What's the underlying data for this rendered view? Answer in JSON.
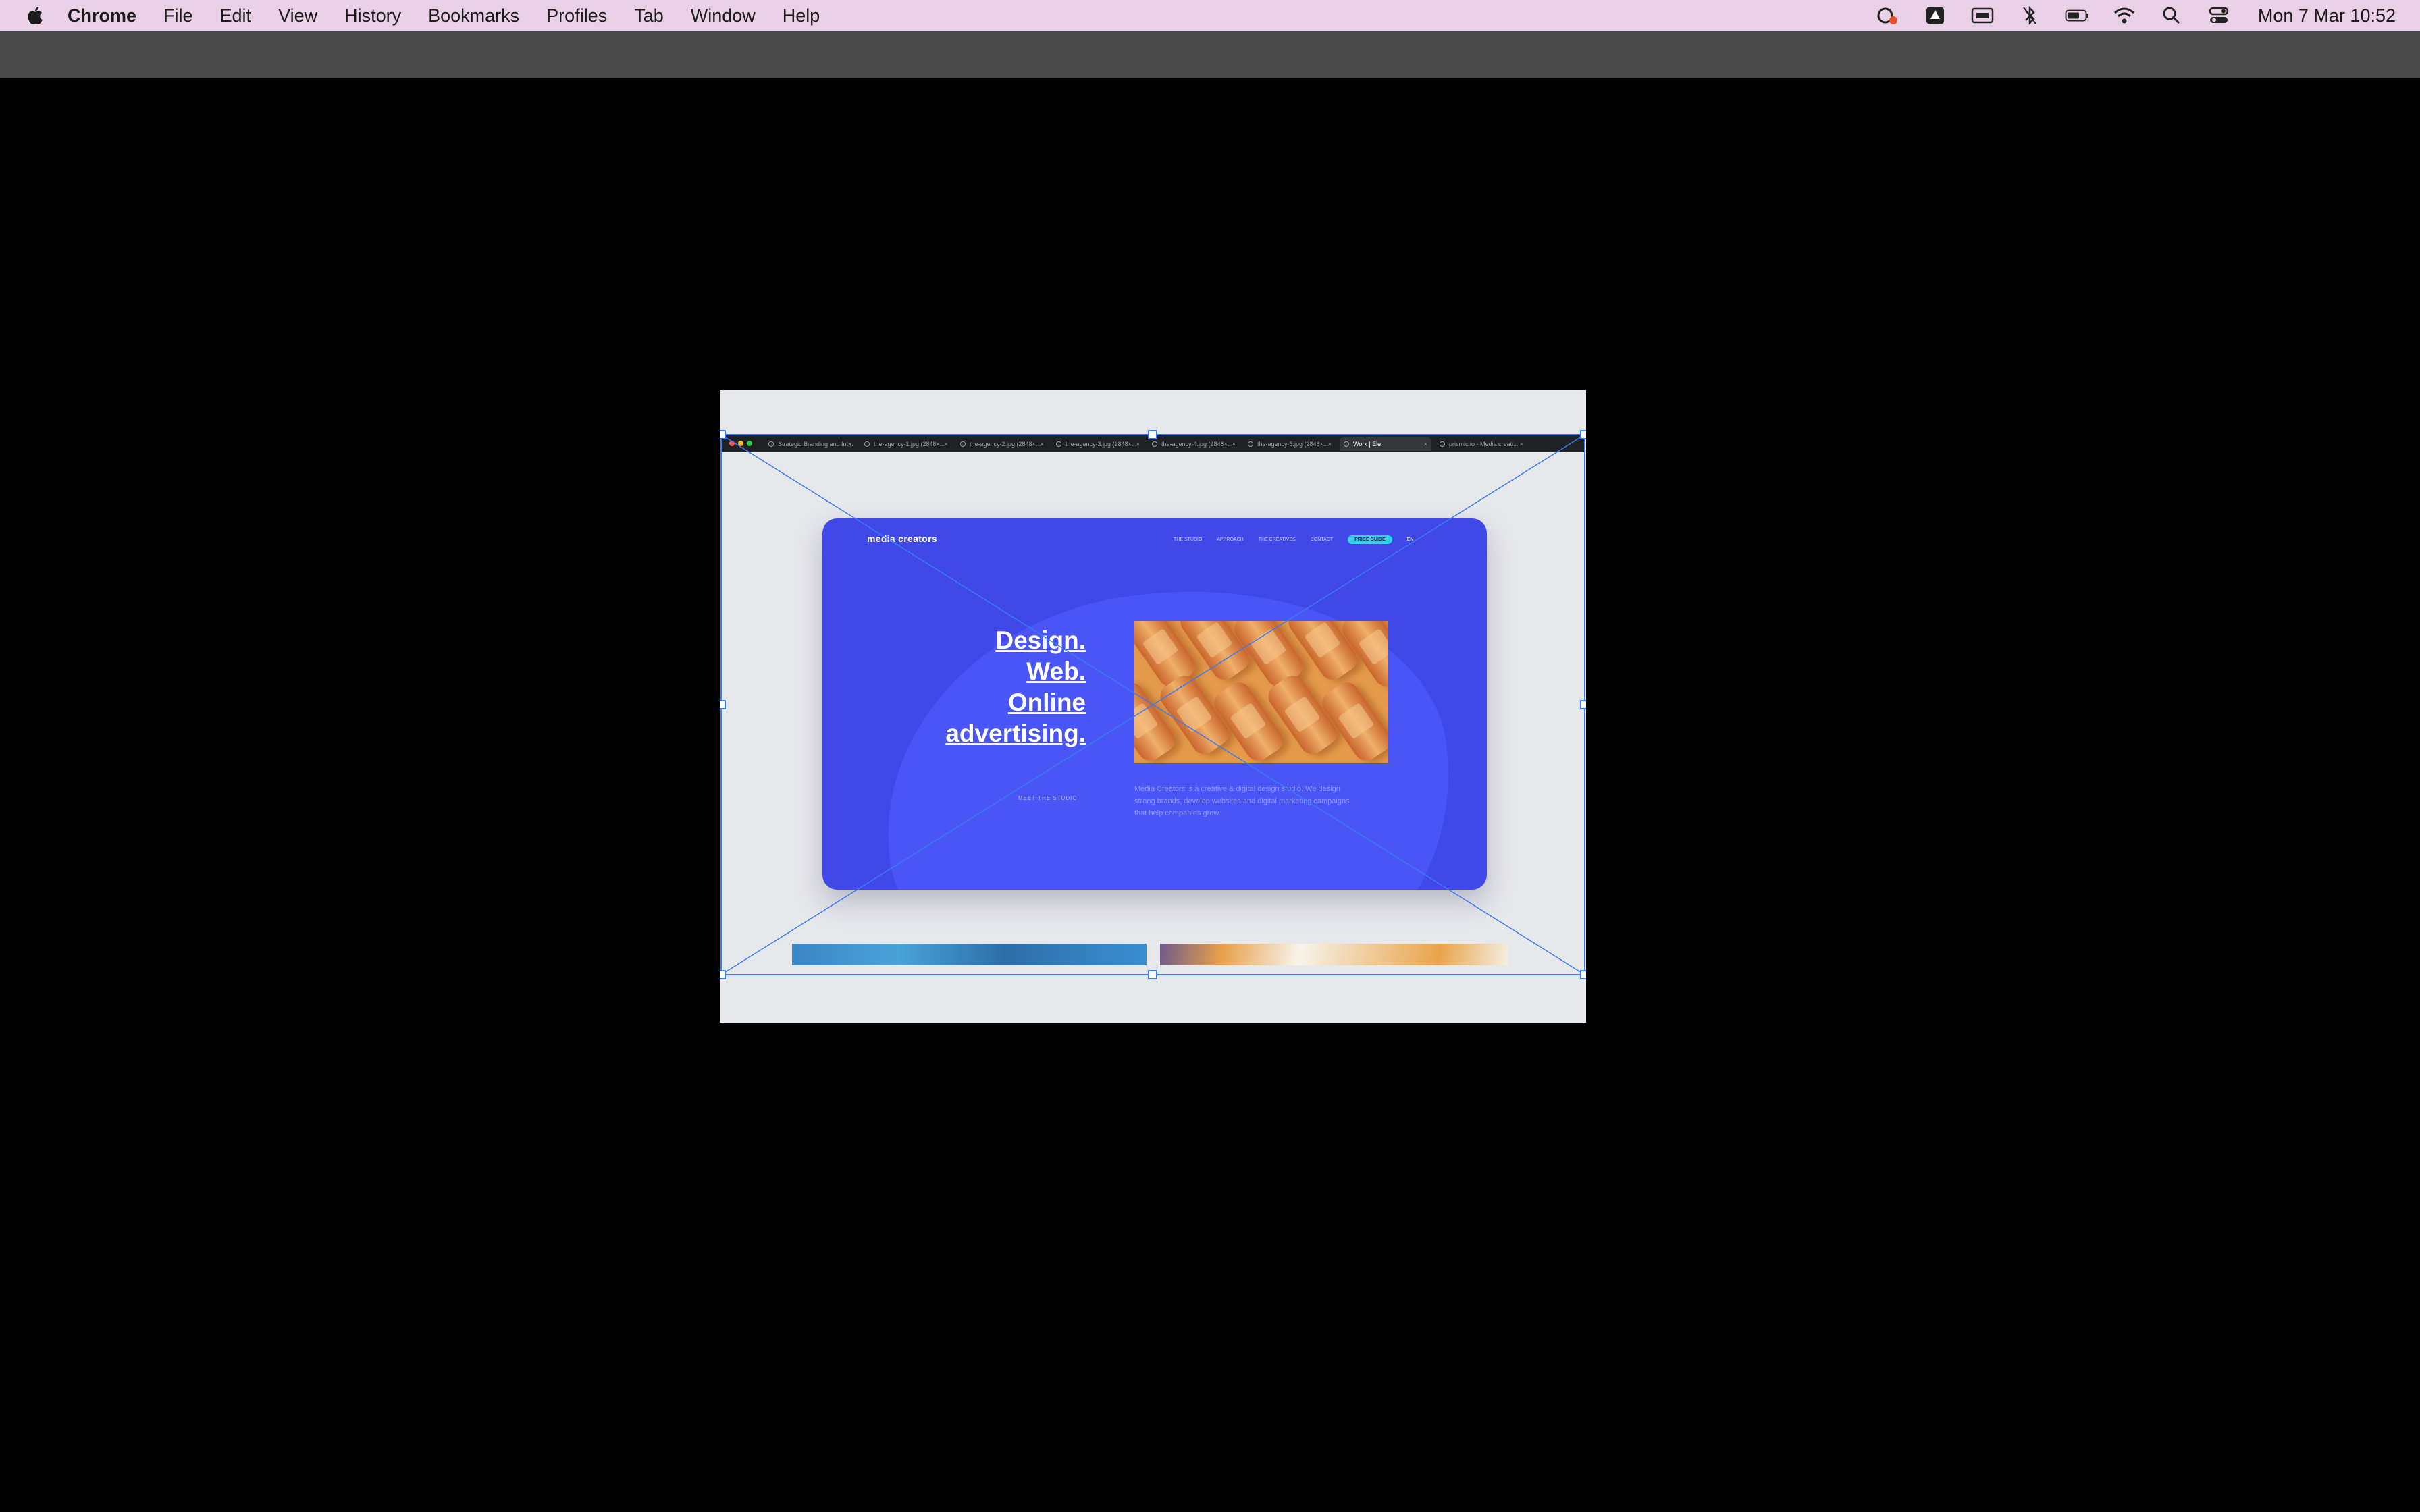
{
  "menubar": {
    "app_name": "Chrome",
    "items": [
      "File",
      "Edit",
      "View",
      "History",
      "Bookmarks",
      "Profiles",
      "Tab",
      "Window",
      "Help"
    ],
    "clock": "Mon 7 Mar  10:52",
    "status_icons": [
      "creative-cloud-icon",
      "google-drive-icon",
      "display-icon",
      "bluetooth-icon",
      "battery-icon",
      "wifi-icon",
      "search-icon",
      "control-center-icon"
    ]
  },
  "screenshot": {
    "tabs": [
      {
        "label": "Strategic Branding and Int...",
        "active": false
      },
      {
        "label": "the-agency-1.jpg (2848×...",
        "active": false
      },
      {
        "label": "the-agency-2.jpg (2848×...",
        "active": false
      },
      {
        "label": "the-agency-3.jpg (2848×...",
        "active": false
      },
      {
        "label": "the-agency-4.jpg (2848×...",
        "active": false
      },
      {
        "label": "the-agency-5.jpg (2848×...",
        "active": false
      },
      {
        "label": "Work | Ele",
        "active": true
      },
      {
        "label": "prismic.io - Media creati...",
        "active": false
      }
    ],
    "site": {
      "logo": "media creators",
      "nav": [
        "THE STUDIO",
        "APPROACH",
        "THE CREATIVES",
        "CONTACT"
      ],
      "nav_cta": "PRICE GUIDE",
      "lang": "EN",
      "headline": [
        "Design.",
        "Web.",
        "Online",
        "advertising."
      ],
      "meet_link": "MEET THE STUDIO",
      "description": "Media Creators is a creative & digital design studio. We design strong brands, develop websites and digital marketing campaigns that help companies grow."
    }
  },
  "colors": {
    "menubar_bg": "#ead0e6",
    "site_bg": "#4048e8",
    "selection": "#3b7cf0"
  }
}
